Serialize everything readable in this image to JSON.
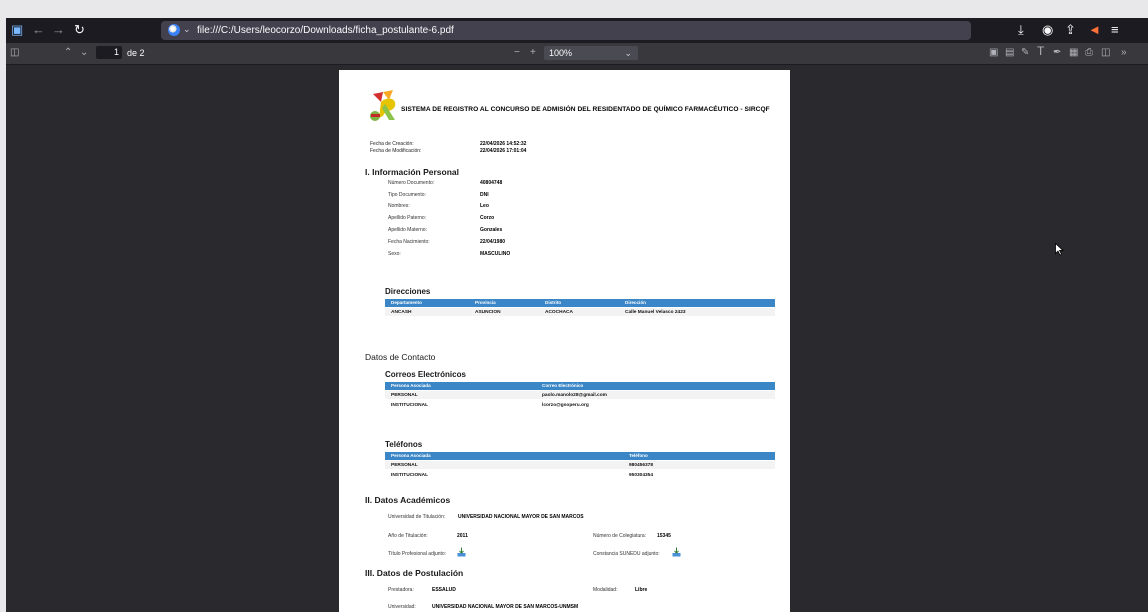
{
  "browser": {
    "url": "file:///C:/Users/leocorzo/Downloads/ficha_postulante-6.pdf"
  },
  "pdf_toolbar": {
    "page_current": "1",
    "page_total": "de 2",
    "zoom": "100%"
  },
  "document": {
    "title": "SISTEMA DE REGISTRO AL CONCURSO DE ADMISIÓN DEL RESIDENTADO DE QUÍMICO FARMACÉUTICO - SIRCQF",
    "meta": [
      {
        "label": "Fecha de Creación:",
        "value": "22/04/2026 14:52:32"
      },
      {
        "label": "Fecha de Modificación:",
        "value": "22/04/2026 17:01:04"
      }
    ],
    "personal": {
      "heading": "I. Información Personal",
      "fields": [
        {
          "label": "Número Documento:",
          "value": "40804748"
        },
        {
          "label": "Tipo Documento:",
          "value": "DNI"
        },
        {
          "label": "Nombres:",
          "value": "Leo"
        },
        {
          "label": "Apellido Paterno:",
          "value": "Corzo"
        },
        {
          "label": "Apellido Materno:",
          "value": "Gonzales"
        },
        {
          "label": "Fecha Nacimiento:",
          "value": "22/04/1980"
        },
        {
          "label": "Sexo:",
          "value": "MASCULINO"
        }
      ]
    },
    "direcciones": {
      "heading": "Direcciones",
      "columns": [
        "Departamento",
        "Provincia",
        "Distrito",
        "Dirección"
      ],
      "rows": [
        [
          "ANCASH",
          "ASUNCION",
          "ACOCHACA",
          "Calle Manuel Velasco 2423"
        ]
      ]
    },
    "contacto": {
      "heading": "Datos de Contacto",
      "correos": {
        "heading": "Correos Electrónicos",
        "columns": [
          "Persona Asociada",
          "Correo Electrónico"
        ],
        "rows": [
          [
            "PERSONAL",
            "paolo.manolo28@gmail.com"
          ],
          [
            "INSTITUCIONAL",
            "lcorzo@gsoperu.org"
          ]
        ]
      },
      "telefonos": {
        "heading": "Teléfonos",
        "columns": [
          "Persona Asociada",
          "Teléfono"
        ],
        "rows": [
          [
            "PERSONAL",
            "980456378"
          ],
          [
            "INSTITUCIONAL",
            "950304354"
          ]
        ]
      }
    },
    "academicos": {
      "heading": "II. Datos Académicos",
      "universidad_label": "Universidad de Titulación:",
      "universidad_value": "UNIVERSIDAD NACIONAL MAYOR DE SAN MARCOS",
      "anio_label": "Año de Titulación:",
      "anio_value": "2011",
      "colegiatura_label": "Número de Colegiatura:",
      "colegiatura_value": "15345",
      "titulo_label": "Título Profesional adjunto:",
      "sunedu_label": "Constancia SUNEDU adjunto:"
    },
    "postulacion": {
      "heading": "III. Datos de Postulación",
      "prestadora_label": "Prestadora:",
      "prestadora_value": "ESSALUD",
      "modalidad_label": "Modalidad:",
      "modalidad_value": "Libre",
      "universidad_label": "Universidad:",
      "universidad_value": "UNIVERSIDAD NACIONAL MAYOR DE SAN MARCOS-UNMSM"
    }
  },
  "colors": {
    "table_header": "#3b86c6",
    "viewer_bg": "#2a2a2e",
    "titlebar_bg": "#1c1b22"
  }
}
